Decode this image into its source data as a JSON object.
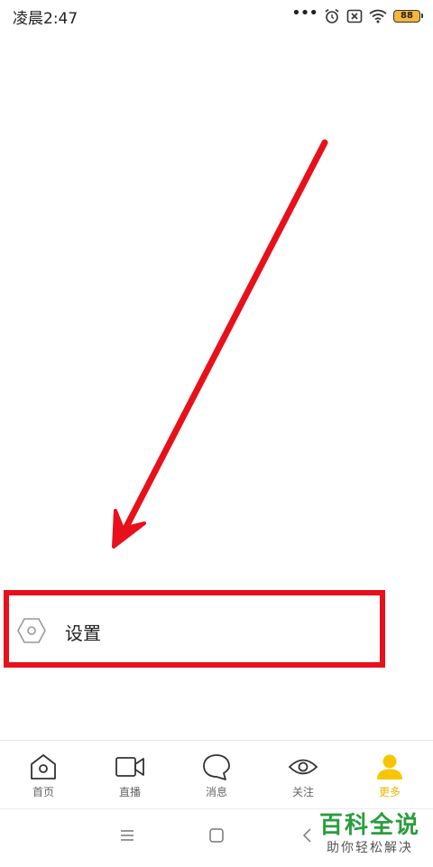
{
  "status_bar": {
    "time": "凌晨2:47",
    "dots": "•••",
    "battery": "88",
    "icons": [
      "alarm-icon",
      "sim-off-icon",
      "wifi-icon",
      "battery-icon"
    ]
  },
  "settings": {
    "label": "设置",
    "icon": "hexagon-settings-icon"
  },
  "annotation": {
    "arrow_color": "#e8101a",
    "box_color": "#e8101a"
  },
  "bottom_nav": {
    "items": [
      {
        "label": "首页",
        "icon": "home-icon"
      },
      {
        "label": "直播",
        "icon": "video-camera-icon"
      },
      {
        "label": "消息",
        "icon": "chat-bubble-icon"
      },
      {
        "label": "关注",
        "icon": "eye-icon"
      },
      {
        "label": "更多",
        "icon": "user-icon",
        "active": true
      }
    ],
    "active_color": "#f2b300"
  },
  "system_nav": {
    "menu": "☰",
    "home": "□",
    "back": "〈"
  },
  "watermark": {
    "title": "百科全说",
    "subtitle": "助你轻松解决"
  }
}
